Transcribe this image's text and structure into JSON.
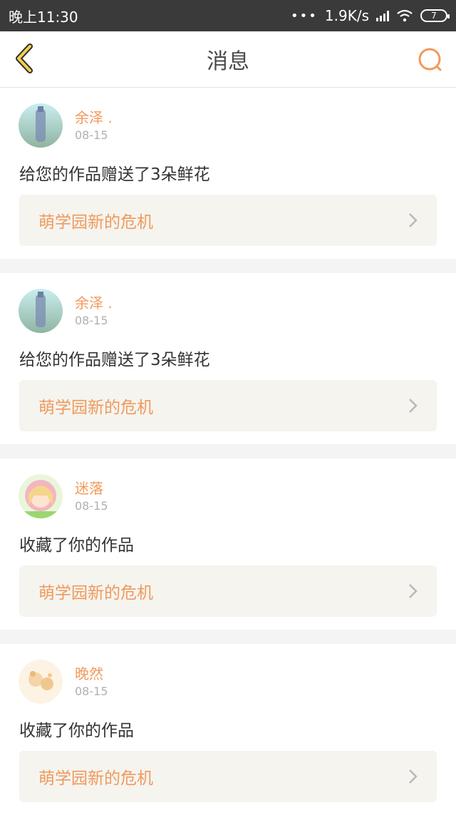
{
  "status_bar": {
    "time": "晚上11:30",
    "net_speed": "1.9K/s",
    "battery": "7"
  },
  "header": {
    "title": "消息",
    "back_icon": "chevron-left-icon",
    "search_icon": "search-icon"
  },
  "colors": {
    "accent": "#f29a5c",
    "back_icon": "#e7c52a",
    "card_link_bg": "#f5f4ef"
  },
  "messages": [
    {
      "user": "余泽 .",
      "date": "08-15",
      "action": "给您的作品赠送了3朵鲜花",
      "work": "萌学园新的危机"
    },
    {
      "user": "余泽 .",
      "date": "08-15",
      "action": "给您的作品赠送了3朵鲜花",
      "work": "萌学园新的危机"
    },
    {
      "user": "迷落",
      "date": "08-15",
      "action": "收藏了你的作品",
      "work": "萌学园新的危机"
    },
    {
      "user": "晚然",
      "date": "08-15",
      "action": "收藏了你的作品",
      "work": "萌学园新的危机"
    }
  ]
}
